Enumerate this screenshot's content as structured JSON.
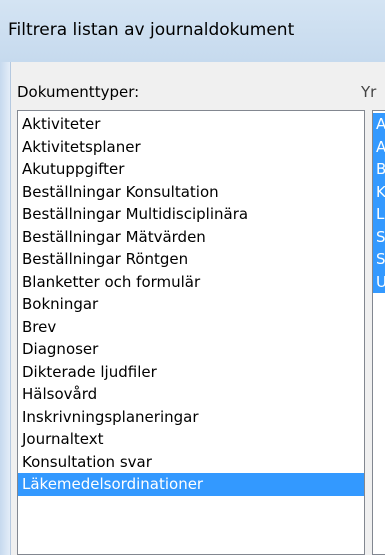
{
  "window": {
    "title": "Filtrera listan av journaldokument"
  },
  "document_types": {
    "label": "Dokumenttyper:",
    "items": [
      {
        "label": "Aktiviteter",
        "selected": false
      },
      {
        "label": "Aktivitetsplaner",
        "selected": false
      },
      {
        "label": "Akutuppgifter",
        "selected": false
      },
      {
        "label": "Beställningar Konsultation",
        "selected": false
      },
      {
        "label": "Beställningar Multidisciplinära",
        "selected": false
      },
      {
        "label": "Beställningar Mätvärden",
        "selected": false
      },
      {
        "label": "Beställningar Röntgen",
        "selected": false
      },
      {
        "label": "Blanketter och formulär",
        "selected": false
      },
      {
        "label": "Bokningar",
        "selected": false
      },
      {
        "label": "Brev",
        "selected": false
      },
      {
        "label": "Diagnoser",
        "selected": false
      },
      {
        "label": "Dikterade ljudfiler",
        "selected": false
      },
      {
        "label": "Hälsovård",
        "selected": false
      },
      {
        "label": "Inskrivningsplaneringar",
        "selected": false
      },
      {
        "label": "Journaltext",
        "selected": false
      },
      {
        "label": "Konsultation svar",
        "selected": false
      },
      {
        "label": "Läkemedelsordinationer",
        "selected": true
      }
    ]
  },
  "professions": {
    "label": "Yr",
    "items": [
      {
        "label": "A",
        "selected": true
      },
      {
        "label": "A",
        "selected": true
      },
      {
        "label": "B",
        "selected": true
      },
      {
        "label": "K",
        "selected": true
      },
      {
        "label": "L",
        "selected": true
      },
      {
        "label": "S",
        "selected": true
      },
      {
        "label": "S",
        "selected": true
      },
      {
        "label": "U",
        "selected": true
      }
    ]
  },
  "colors": {
    "selection": "#3399ff",
    "title_bar": "#c6daee"
  }
}
